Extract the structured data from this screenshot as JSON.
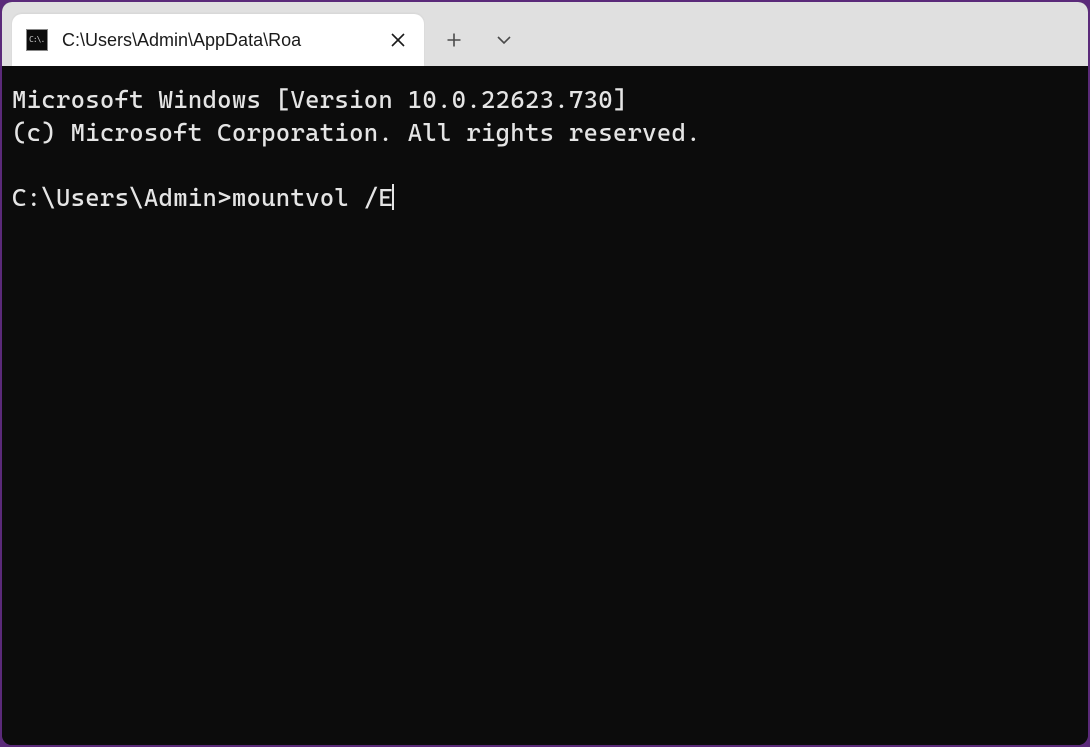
{
  "tab": {
    "title": "C:\\Users\\Admin\\AppData\\Roa",
    "icon_text": "C:\\."
  },
  "terminal": {
    "banner_line1": "Microsoft Windows [Version 10.0.22623.730]",
    "banner_line2": "(c) Microsoft Corporation. All rights reserved.",
    "prompt": "C:\\Users\\Admin>",
    "command": "mountvol /E"
  }
}
